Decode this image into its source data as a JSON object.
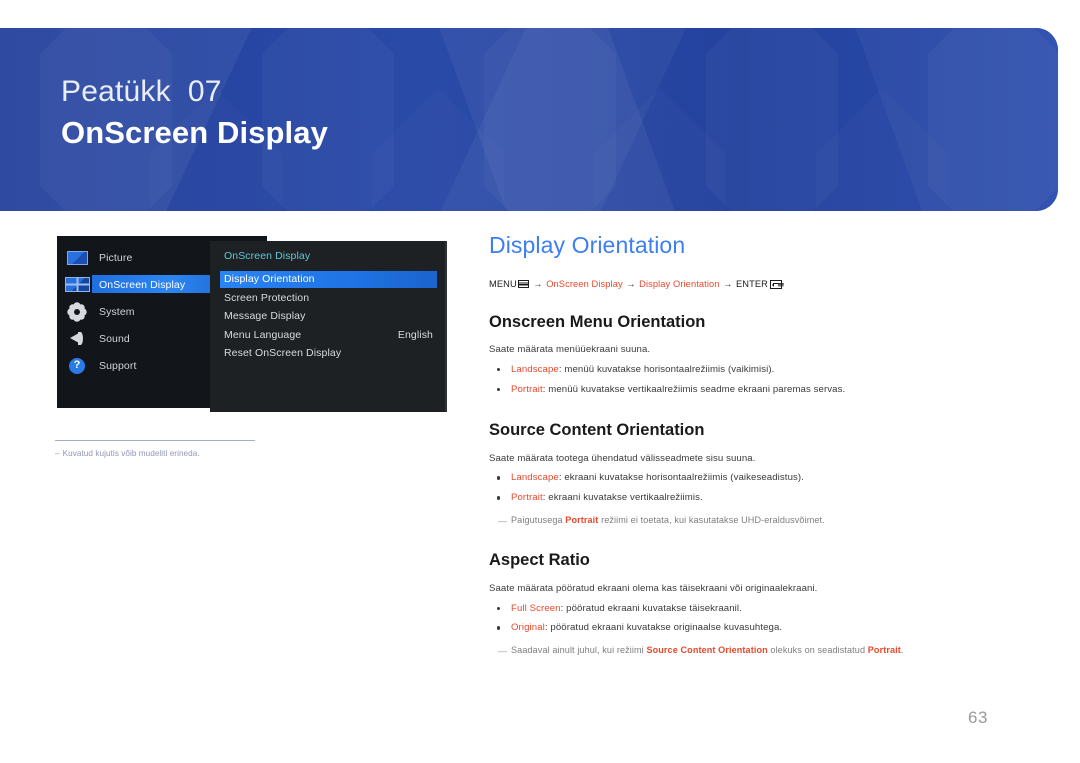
{
  "banner": {
    "chapter_label": "Peatükk  07",
    "title": "OnScreen Display",
    "bg_color": "#22409a"
  },
  "osd": {
    "menu_items": [
      {
        "label": "Picture",
        "icon": "picture-icon",
        "selected": false
      },
      {
        "label": "OnScreen Display",
        "icon": "onscreen-display-icon",
        "selected": true
      },
      {
        "label": "System",
        "icon": "gear-icon",
        "selected": false
      },
      {
        "label": "Sound",
        "icon": "speaker-icon",
        "selected": false
      },
      {
        "label": "Support",
        "icon": "help-circle-icon",
        "selected": false
      }
    ],
    "panel_title": "OnScreen Display",
    "sub_items": [
      {
        "label": "Display Orientation",
        "value": "",
        "selected": true
      },
      {
        "label": "Screen Protection",
        "value": "",
        "selected": false
      },
      {
        "label": "Message Display",
        "value": "",
        "selected": false
      },
      {
        "label": "Menu Language",
        "value": "English",
        "selected": false
      },
      {
        "label": "Reset OnScreen Display",
        "value": "",
        "selected": false
      }
    ]
  },
  "left_note": {
    "dash": "–",
    "text": "Kuvatud kujutis võib mudeliti erineda."
  },
  "content": {
    "title": "Display Orientation",
    "path": {
      "menu_word": "MENU",
      "menu_icon": "menu-grid-icon",
      "arrow": "→",
      "step1": "OnScreen Display",
      "step2": "Display Orientation",
      "enter_word": "ENTER",
      "enter_icon": "enter-key-icon"
    },
    "sections": [
      {
        "heading": "Onscreen Menu Orientation",
        "intro": "Saate määrata menüüekraani suuna.",
        "bullets": [
          {
            "kw": "Landscape",
            "rest": ": menüü kuvatakse horisontaalrežiimis (vaikimisi)."
          },
          {
            "kw": "Portrait",
            "rest": ": menüü kuvatakse vertikaalrežiimis seadme ekraani paremas servas."
          }
        ],
        "note": null
      },
      {
        "heading": "Source Content Orientation",
        "intro": "Saate määrata tootega ühendatud välisseadmete sisu suuna.",
        "bullets": [
          {
            "kw": "Landscape",
            "rest": ": ekraani kuvatakse horisontaalrežiimis (vaikeseadistus)."
          },
          {
            "kw": "Portrait",
            "rest": ": ekraani kuvatakse vertikaalrežiimis."
          }
        ],
        "note": {
          "dash": "—",
          "part1": "Paigutusega ",
          "kw1": "Portrait",
          "part2": " režiimi ei toetata, kui kasutatakse UHD-eraldusvõimet.",
          "kw2": "",
          "part3": ""
        }
      },
      {
        "heading": "Aspect Ratio",
        "intro": "Saate määrata pööratud ekraani olema kas täisekraani või originaalekraani.",
        "bullets": [
          {
            "kw": "Full Screen",
            "rest": ": pööratud ekraani kuvatakse täisekraanil."
          },
          {
            "kw": "Original",
            "rest": ": pööratud ekraani kuvatakse originaalse kuvasuhtega."
          }
        ],
        "note": {
          "dash": "—",
          "part1": "Saadaval ainult juhul, kui režiimi ",
          "kw1": "Source Content Orientation",
          "part2": " olekuks on seadistatud ",
          "kw2": "Portrait",
          "part3": "."
        }
      }
    ]
  },
  "page_number": "63",
  "colors": {
    "banner_blue": "#22409a",
    "title_blue": "#3d7ef2",
    "keyword_red": "#e8482b",
    "osd_teal": "#5fc8d6",
    "osd_highlight": "#2a84f3"
  }
}
